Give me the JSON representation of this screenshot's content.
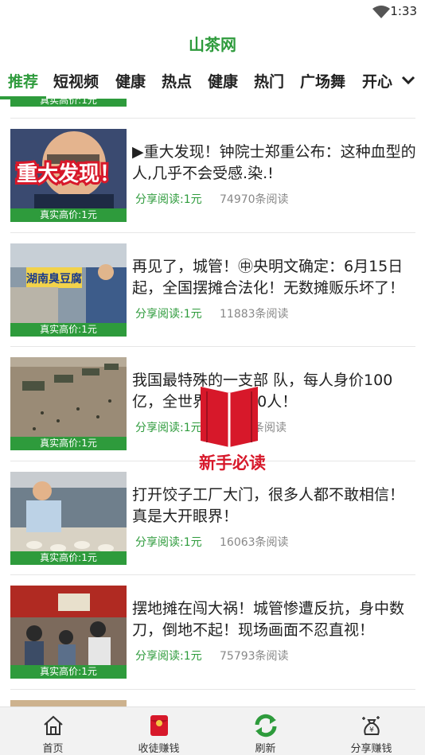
{
  "status_bar": {
    "time": "1:33"
  },
  "app": {
    "title": "山茶网"
  },
  "tabs": [
    {
      "label": "推荐",
      "active": true
    },
    {
      "label": "短视频"
    },
    {
      "label": "健康"
    },
    {
      "label": "热点"
    },
    {
      "label": "健康"
    },
    {
      "label": "热门"
    },
    {
      "label": "广场舞"
    },
    {
      "label": "开心"
    }
  ],
  "feed": {
    "price_tag": "真实高价:1元",
    "items": [
      {
        "title": "▶重大发现！钟院士郑重公布：这种血型的人,几乎不会受感.染.!",
        "share": "分享阅读:1元",
        "reads": "74970条阅读",
        "thumb_text": "重大发现！"
      },
      {
        "title": "再见了，城管！㊥央明文确定：6月15日起，全国摆摊合法化！无数摊贩乐坏了！",
        "share": "分享阅读:1元",
        "reads": "11883条阅读",
        "thumb_text": "湖南臭豆腐"
      },
      {
        "title": "我国最特殊的一支部 队，每人身价100亿，全世界仅有400人！",
        "share": "分享阅读:1元",
        "reads": "条阅读"
      },
      {
        "title": "打开饺子工厂大门，很多人都不敢相信！真是大开眼界！",
        "share": "分享阅读:1元",
        "reads": "16063条阅读"
      },
      {
        "title": "摆地摊在闯大祸！城管惨遭反抗，身中数刀，倒地不起！现场画面不忍直视！",
        "share": "分享阅读:1元",
        "reads": "75793条阅读"
      }
    ]
  },
  "overlay": {
    "label": "新手必读"
  },
  "bottom_nav": [
    {
      "label": "首页",
      "icon": "home-icon"
    },
    {
      "label": "收徒赚钱",
      "icon": "red-envelope-icon"
    },
    {
      "label": "刷新",
      "icon": "refresh-icon"
    },
    {
      "label": "分享赚钱",
      "icon": "money-bag-icon"
    }
  ],
  "colors": {
    "brand": "#2e9b3c",
    "overlay_red": "#d7182a"
  }
}
